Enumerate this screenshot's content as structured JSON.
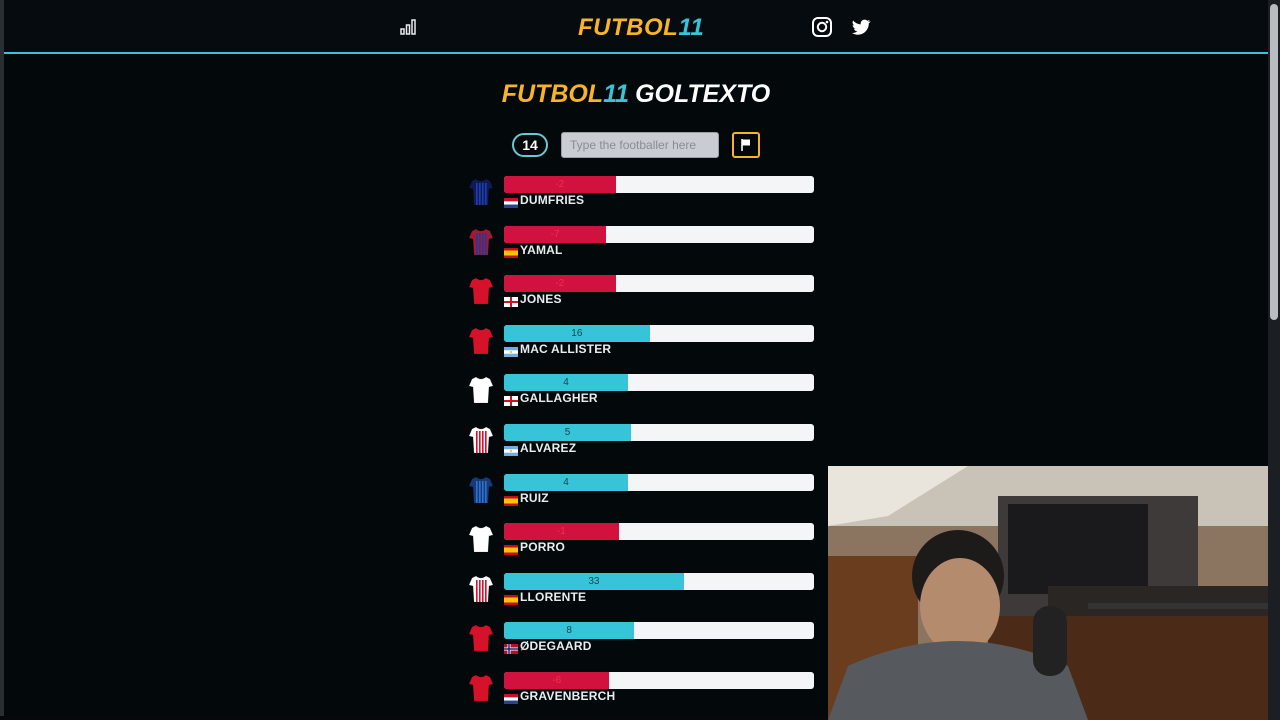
{
  "header": {
    "logo_part1": "FUTBOL",
    "logo_part2": "11",
    "icons": [
      "stats-icon",
      "instagram-icon",
      "twitter-icon"
    ]
  },
  "game": {
    "title_part1": "FUTBOL",
    "title_part2": "11",
    "title_part3": "GOLTEXTO",
    "guess_count": "14",
    "input_placeholder": "Type the footballer here"
  },
  "colors": {
    "gold": "#f6b426",
    "cyan": "#37c4d8",
    "red": "#d2123e",
    "bar_bg": "#f4f5f6"
  },
  "players": [
    {
      "name": "DUMFRIES",
      "value": "-2",
      "color": "red",
      "fill": 0.36,
      "shirt": "#111a56",
      "shirt_stripe": "#1f3fae",
      "flag": "nl"
    },
    {
      "name": "YAMAL",
      "value": "-7",
      "color": "red",
      "fill": 0.33,
      "shirt": "#a01a35",
      "shirt_stripe": "#1d3b9e",
      "flag": "es"
    },
    {
      "name": "JONES",
      "value": "-2",
      "color": "red",
      "fill": 0.36,
      "shirt": "#d6112a",
      "shirt_stripe": "#d6112a",
      "flag": "en"
    },
    {
      "name": "MAC ALLISTER",
      "value": "16",
      "color": "cyan",
      "fill": 0.47,
      "shirt": "#d6112a",
      "shirt_stripe": "#d6112a",
      "flag": "ar"
    },
    {
      "name": "GALLAGHER",
      "value": "4",
      "color": "cyan",
      "fill": 0.4,
      "shirt": "#ffffff",
      "shirt_stripe": "#ffffff",
      "flag": "en"
    },
    {
      "name": "ALVAREZ",
      "value": "5",
      "color": "cyan",
      "fill": 0.41,
      "shirt": "#ffffff",
      "shirt_stripe": "#d6112a",
      "flag": "ar"
    },
    {
      "name": "RUIZ",
      "value": "4",
      "color": "cyan",
      "fill": 0.4,
      "shirt": "#173a7a",
      "shirt_stripe": "#2f6fd0",
      "flag": "es"
    },
    {
      "name": "PORRO",
      "value": "-1",
      "color": "red",
      "fill": 0.37,
      "shirt": "#ffffff",
      "shirt_stripe": "#ffffff",
      "flag": "es"
    },
    {
      "name": "LLORENTE",
      "value": "33",
      "color": "cyan",
      "fill": 0.58,
      "shirt": "#ffffff",
      "shirt_stripe": "#d6112a",
      "flag": "es"
    },
    {
      "name": "ØDEGAARD",
      "value": "8",
      "color": "cyan",
      "fill": 0.42,
      "shirt": "#d6112a",
      "shirt_stripe": "#d6112a",
      "flag": "no"
    },
    {
      "name": "GRAVENBERCH",
      "value": "-6",
      "color": "red",
      "fill": 0.34,
      "shirt": "#d6112a",
      "shirt_stripe": "#d6112a",
      "flag": "nl"
    }
  ]
}
